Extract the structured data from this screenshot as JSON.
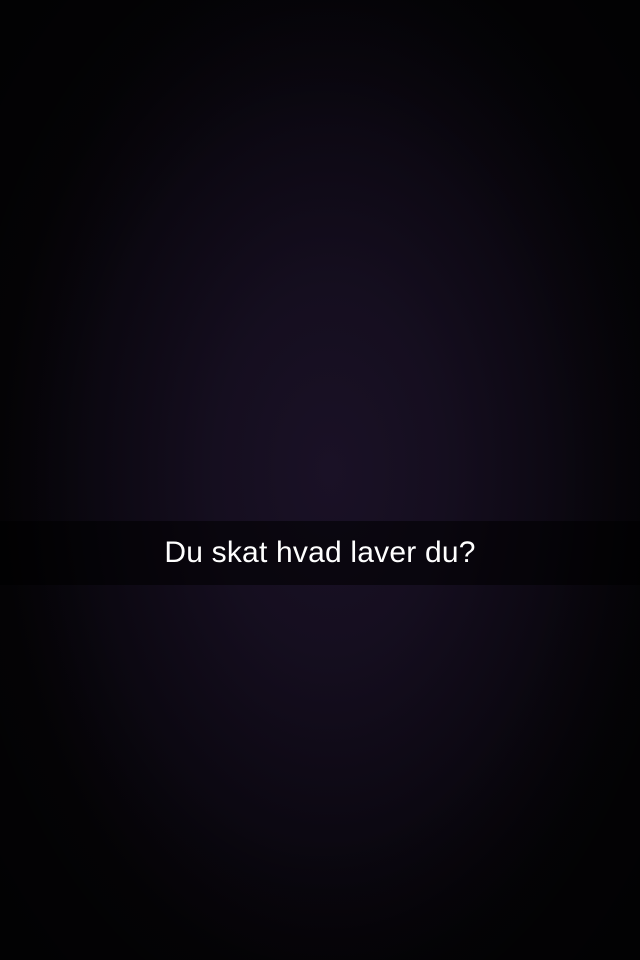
{
  "snap": {
    "caption": "Du skat hvad laver du?"
  },
  "colors": {
    "background": "#050308",
    "vignette_center": "#1a1126",
    "caption_bar": "rgba(0,0,0,0.55)",
    "caption_text": "#ffffff"
  }
}
